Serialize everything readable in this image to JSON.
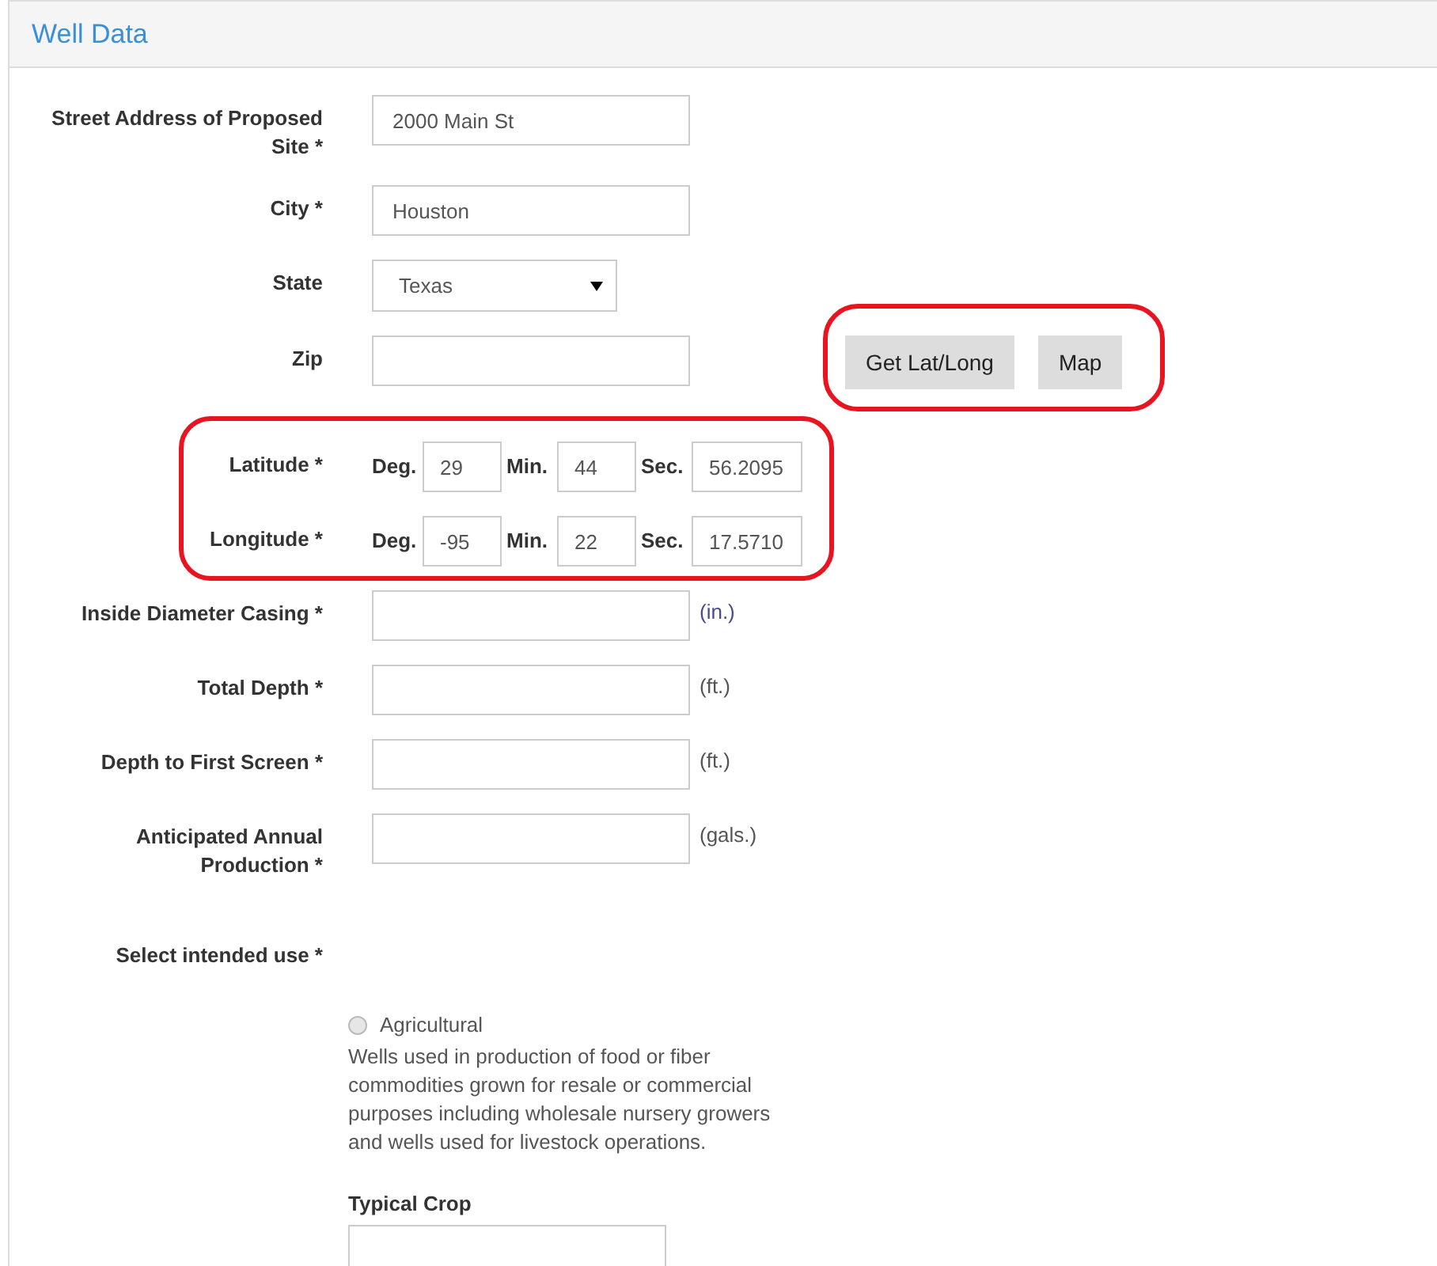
{
  "panel": {
    "title": "Well Data"
  },
  "fields": [
    {
      "kind": "text",
      "label": "Street Address of Proposed Site *",
      "value": "2000 Main St"
    },
    {
      "kind": "text",
      "label": "City *",
      "value": "Houston"
    },
    {
      "kind": "select",
      "label": "State",
      "value": "Texas"
    },
    {
      "kind": "text",
      "label": "Zip",
      "actions": [
        "Get Lat/Long",
        "Map"
      ]
    }
  ],
  "coordinates": [
    {
      "label": "Latitude *",
      "parts": [
        {
          "label": "Deg.",
          "value": "29"
        },
        {
          "label": "Min.",
          "value": "44"
        },
        {
          "label": "Sec.",
          "value": "56.2095"
        }
      ]
    },
    {
      "label": "Longitude *",
      "parts": [
        {
          "label": "Deg.",
          "value": "-95"
        },
        {
          "label": "Min.",
          "value": "22"
        },
        {
          "label": "Sec.",
          "value": "17.5710"
        }
      ]
    }
  ],
  "measurements": [
    {
      "label": "Inside Diameter Casing *",
      "unit": "(in.)"
    },
    {
      "label": "Total Depth *",
      "unit": "(ft.)"
    },
    {
      "label": "Depth to First Screen *",
      "unit": "(ft.)"
    },
    {
      "label": "Anticipated Annual Production *",
      "unit": "(gals.)"
    }
  ],
  "intended_use": {
    "label": "Select intended use *",
    "options": [
      {
        "label": "Agricultural",
        "selected": false,
        "description": "Wells used in production of food or fiber commodities grown for resale or commercial purposes including wholesale nursery growers and wells used for livestock operations.",
        "followup": {
          "label": "Typical Crop"
        }
      }
    ]
  }
}
